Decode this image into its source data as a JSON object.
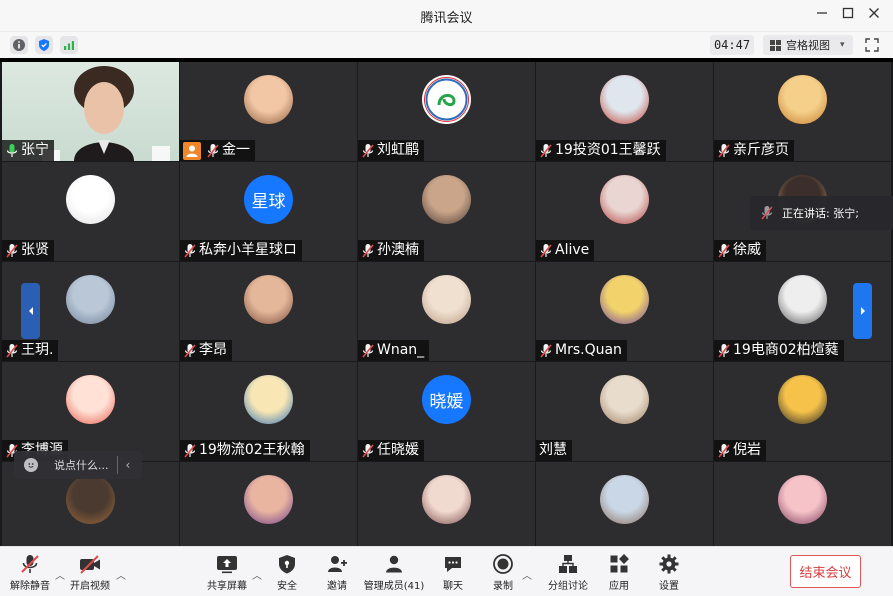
{
  "window": {
    "title": "腾讯会议"
  },
  "infobar": {
    "timer": "04:47",
    "view_label": "宫格视图"
  },
  "participants": [
    {
      "name": "张宁",
      "avatar": "video-feed",
      "host": false,
      "mic": "on"
    },
    {
      "name": "金一",
      "avatar": "photo",
      "host": true,
      "mic": "muted"
    },
    {
      "name": "刘虹鹛",
      "avatar": "logo",
      "host": false,
      "mic": "muted"
    },
    {
      "name": "19投资01王馨跃",
      "avatar": "photo",
      "host": false,
      "mic": "muted"
    },
    {
      "name": "亲斤彦页",
      "avatar": "photo",
      "host": false,
      "mic": "muted"
    },
    {
      "name": "张贤",
      "avatar": "photo",
      "host": false,
      "mic": "muted"
    },
    {
      "name": "私奔小羊星球ロ",
      "avatar": "text",
      "avatar_text": "星球",
      "avatar_color": "#1677ff",
      "host": false,
      "mic": "muted"
    },
    {
      "name": "孙澳楠",
      "avatar": "photo",
      "host": false,
      "mic": "muted"
    },
    {
      "name": "Alive",
      "avatar": "photo",
      "host": false,
      "mic": "muted"
    },
    {
      "name": "徐威",
      "avatar": "photo",
      "host": false,
      "mic": "muted"
    },
    {
      "name": "王玥.",
      "avatar": "photo",
      "host": false,
      "mic": "muted"
    },
    {
      "name": "李昂",
      "avatar": "photo",
      "host": false,
      "mic": "muted"
    },
    {
      "name": "Wnan_",
      "avatar": "photo",
      "host": false,
      "mic": "muted"
    },
    {
      "name": "Mrs.Quan",
      "avatar": "photo",
      "host": false,
      "mic": "muted"
    },
    {
      "name": "19电商02柏煊蕤",
      "avatar": "photo",
      "host": false,
      "mic": "muted"
    },
    {
      "name": "李博源",
      "avatar": "photo",
      "host": false,
      "mic": "muted"
    },
    {
      "name": "19物流02王秋翰",
      "avatar": "photo",
      "host": false,
      "mic": "muted"
    },
    {
      "name": "任晓媛",
      "avatar": "text",
      "avatar_text": "晓媛",
      "avatar_color": "#1677ff",
      "host": false,
      "mic": "muted"
    },
    {
      "name": "刘慧",
      "avatar": "photo",
      "host": false,
      "mic": "none"
    },
    {
      "name": "倪岩",
      "avatar": "photo",
      "host": false,
      "mic": "muted"
    },
    {
      "name": "",
      "avatar": "photo",
      "host": false,
      "mic": "partial"
    },
    {
      "name": "",
      "avatar": "photo",
      "host": false,
      "mic": "partial"
    },
    {
      "name": "",
      "avatar": "photo",
      "host": false,
      "mic": "partial"
    },
    {
      "name": "",
      "avatar": "photo",
      "host": false,
      "mic": "partial"
    },
    {
      "name": "",
      "avatar": "photo",
      "host": false,
      "mic": "partial"
    }
  ],
  "speaking_indicator": {
    "label": "正在讲话: 张宁;"
  },
  "chat": {
    "placeholder": "说点什么..."
  },
  "toolbar": {
    "unmute_label": "解除静音",
    "start_video_label": "开启视频",
    "share_screen_label": "共享屏幕",
    "security_label": "安全",
    "invite_label": "邀请",
    "manage_members_label": "管理成员(41)",
    "chat_label": "聊天",
    "record_label": "录制",
    "breakout_label": "分组讨论",
    "apps_label": "应用",
    "settings_label": "设置",
    "end_meeting_label": "结束会议"
  },
  "colors": {
    "accent_blue": "#1677ff",
    "end_red": "#d83b3b",
    "host_orange": "#f0862a",
    "muted_red": "#e24b4b",
    "tile_bg": "#2d2d30"
  }
}
